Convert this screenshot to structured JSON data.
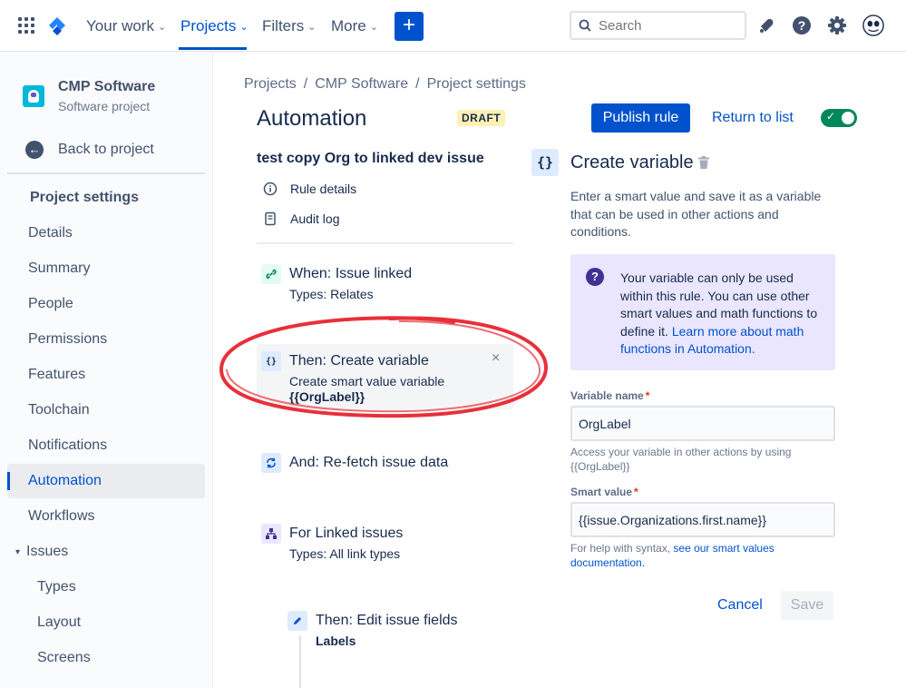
{
  "topnav": {
    "your_work": "Your work",
    "projects": "Projects",
    "filters": "Filters",
    "more": "More",
    "create_label": "+",
    "search_placeholder": "Search",
    "icons": [
      "app-switcher-icon",
      "jira-logo-icon",
      "notifications-icon",
      "help-icon",
      "settings-icon",
      "profile-avatar-icon"
    ]
  },
  "sidebar": {
    "project_name": "CMP Software",
    "project_type": "Software project",
    "back_label": "Back to project",
    "heading": "Project settings",
    "items": [
      {
        "label": "Details"
      },
      {
        "label": "Summary"
      },
      {
        "label": "People"
      },
      {
        "label": "Permissions"
      },
      {
        "label": "Features"
      },
      {
        "label": "Toolchain"
      },
      {
        "label": "Notifications"
      },
      {
        "label": "Automation",
        "active": true
      },
      {
        "label": "Workflows"
      },
      {
        "label": "Issues",
        "expanded": true
      },
      {
        "label": "Types",
        "sub": true
      },
      {
        "label": "Layout",
        "sub": true
      },
      {
        "label": "Screens",
        "sub": true
      }
    ]
  },
  "main": {
    "breadcrumb": [
      "Projects",
      "/",
      "CMP Software",
      "/",
      "Project settings"
    ],
    "title": "Automation",
    "status_badge": "DRAFT",
    "publish_label": "Publish rule",
    "return_label": "Return to list",
    "toggle_on": true,
    "rule_name": "test copy Org to linked dev issue",
    "rule_details": "Rule details",
    "audit_log": "Audit log",
    "steps": [
      {
        "title": "When: Issue linked",
        "sub": "Types: Relates"
      },
      {
        "title": "Then: Create variable",
        "sub": "Create smart value variable",
        "sub2": "{{OrgLabel}}",
        "close": "×"
      },
      {
        "title": "And: Re-fetch issue data"
      },
      {
        "title": "For Linked issues",
        "sub": "Types: All link types"
      },
      {
        "title": "Then: Edit issue fields",
        "sub2": "Labels"
      }
    ]
  },
  "panel": {
    "icon_text": "{}",
    "title": "Create variable",
    "description": "Enter a smart value and save it as a variable that can be used in other actions and conditions.",
    "info_text": "Your variable can only be used within this rule. You can use other smart values and math functions to define it.",
    "info_link": "Learn more about math functions in Automation.",
    "variable_name_label": "Variable name",
    "variable_name_value": "OrgLabel",
    "variable_help": "Access your variable in other actions by using {{OrgLabel}}",
    "smart_value_label": "Smart value",
    "smart_value_value": "{{issue.Organizations.first.name}}",
    "smart_help_prefix": "For help with syntax,",
    "smart_help_link": "see our smart values documentation.",
    "cancel_label": "Cancel",
    "save_label": "Save",
    "required_mark": "*"
  },
  "colors": {
    "accent": "#0052CC",
    "annotation": "#E8303A",
    "toggle_on": "#00875A",
    "info_bg": "#EAE6FF"
  }
}
